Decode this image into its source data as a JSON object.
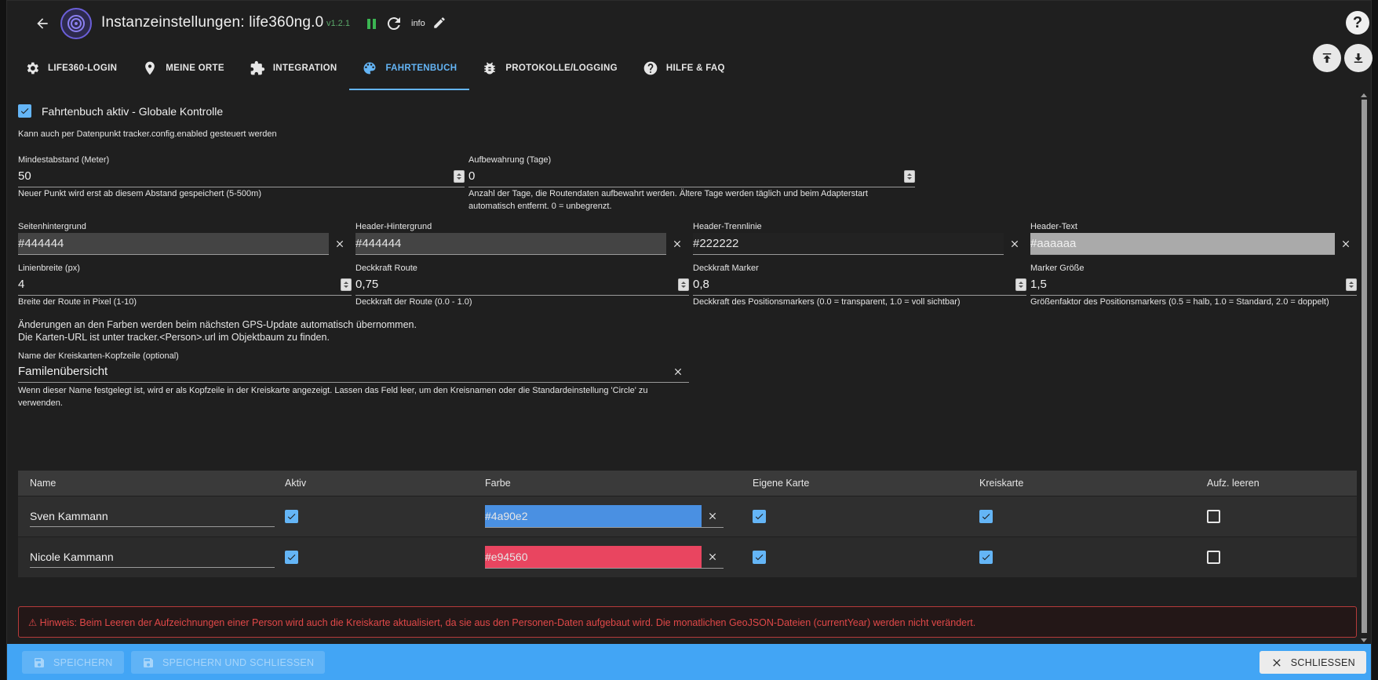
{
  "header": {
    "title": "Instanzeinstellungen: life360ng.0",
    "version": "v1.2.1",
    "info_label": "info",
    "help_symbol": "?"
  },
  "tabs": [
    {
      "label": "LIFE360-LOGIN",
      "icon": "gear-icon"
    },
    {
      "label": "MEINE ORTE",
      "icon": "map-pin-icon"
    },
    {
      "label": "INTEGRATION",
      "icon": "puzzle-icon"
    },
    {
      "label": "FAHRTENBUCH",
      "icon": "palette-icon",
      "active": true
    },
    {
      "label": "PROTOKOLLE/LOGGING",
      "icon": "bug-icon"
    },
    {
      "label": "HILFE & FAQ",
      "icon": "help-circle-icon"
    }
  ],
  "main": {
    "global_control": {
      "label": "Fahrtenbuch aktiv - Globale Kontrolle",
      "checked": true,
      "hint": "Kann auch per Datenpunkt tracker.config.enabled gesteuert werden"
    },
    "min_distance": {
      "label": "Mindestabstand (Meter)",
      "value": "50",
      "help": "Neuer Punkt wird erst ab diesem Abstand gespeichert (5-500m)"
    },
    "retention": {
      "label": "Aufbewahrung (Tage)",
      "value": "0",
      "help_line1": "Anzahl der Tage, die Routendaten aufbewahrt werden. Ältere Tage werden täglich und beim Adapterstart",
      "help_line2": "automatisch entfernt. 0 = unbegrenzt."
    },
    "colors": {
      "page_bg": {
        "label": "Seitenhintergrund",
        "value": "#444444"
      },
      "header_bg": {
        "label": "Header-Hintergrund",
        "value": "#444444"
      },
      "header_line": {
        "label": "Header-Trennlinie",
        "value": "#222222"
      },
      "header_text": {
        "label": "Header-Text",
        "value": "#aaaaaa"
      }
    },
    "line_width": {
      "label": "Linienbreite (px)",
      "value": "4",
      "help": "Breite der Route in Pixel (1-10)"
    },
    "route_opacity": {
      "label": "Deckkraft Route",
      "value": "0,75",
      "help": "Deckkraft der Route (0.0 - 1.0)"
    },
    "marker_opacity": {
      "label": "Deckkraft Marker",
      "value": "0,8",
      "help": "Deckkraft des Positionsmarkers (0.0 = transparent, 1.0 = voll sichtbar)"
    },
    "marker_size": {
      "label": "Marker Größe",
      "value": "1,5",
      "help": "Größenfaktor des Positionsmarkers (0.5 = halb, 1.0 = Standard, 2.0 = doppelt)"
    },
    "note_line1": "Änderungen an den Farben werden beim nächsten GPS-Update automatisch übernommen.",
    "note_line2": "Die Karten-URL ist unter tracker.<Person>.url im Objektbaum zu finden.",
    "circle_header": {
      "label": "Name der Kreiskarten-Kopfzeile (optional)",
      "value": "Familenübersicht",
      "help_line1": "Wenn dieser Name festgelegt ist, wird er als Kopfzeile in der Kreiskarte angezeigt. Lassen das Feld leer, um den Kreisnamen oder die Standardeinstellung 'Circle' zu",
      "help_line2": "verwenden."
    },
    "table": {
      "columns": [
        "Name",
        "Aktiv",
        "Farbe",
        "Eigene Karte",
        "Kreiskarte",
        "Aufz. leeren"
      ],
      "rows": [
        {
          "name": "Sven Kammann",
          "active": true,
          "color": "#4a90e2",
          "own_map": true,
          "circle_map": true,
          "clear": false
        },
        {
          "name": "Nicole Kammann",
          "active": true,
          "color": "#e94560",
          "own_map": true,
          "circle_map": true,
          "clear": false
        }
      ]
    },
    "warning": "⚠ Hinweis: Beim Leeren der Aufzeichnungen einer Person wird auch die Kreiskarte aktualisiert, da sie aus den Personen-Daten aufgebaut wird. Die monatlichen GeoJSON-Dateien (currentYear) werden nicht verändert."
  },
  "footer": {
    "save": "SPEICHERN",
    "save_close": "SPEICHERN UND SCHLIESSEN",
    "close": "SCHLIESSEN"
  },
  "colors": {
    "accent": "#64b5f6",
    "footer_bg": "#42a5f5",
    "warning": "#e04848",
    "version_green": "#5aa86a"
  }
}
